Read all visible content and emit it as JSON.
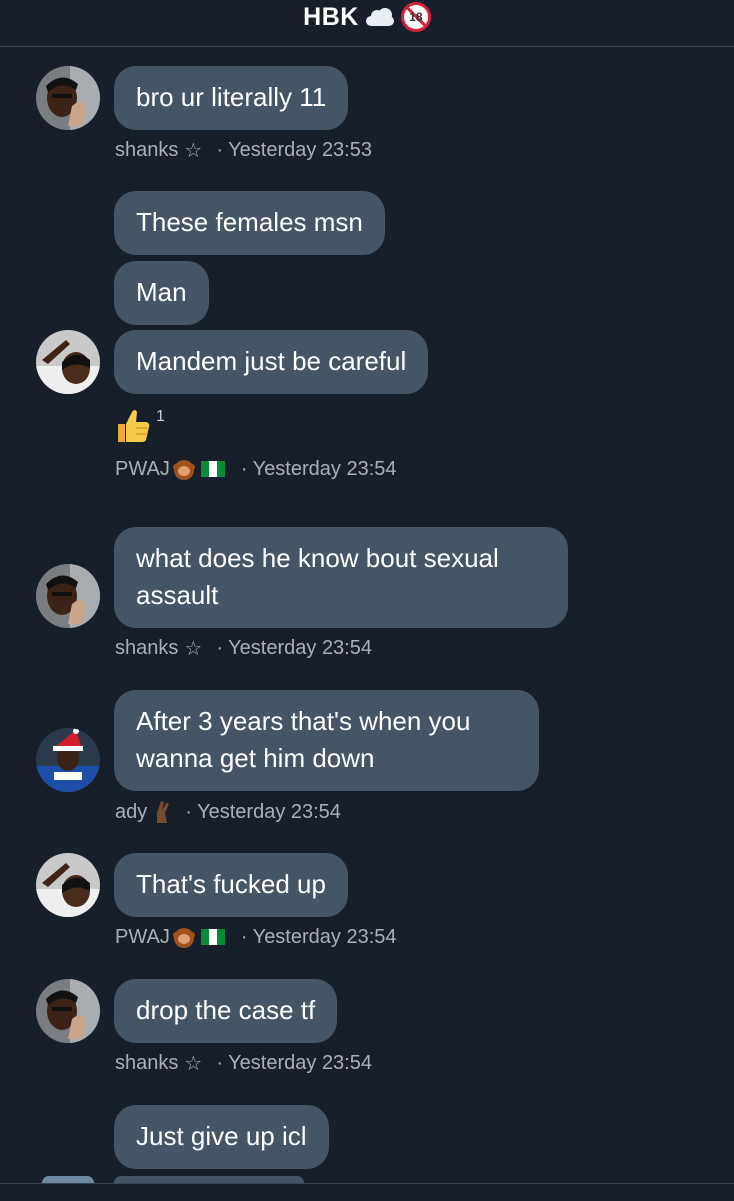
{
  "header": {
    "title": "HBK",
    "icons": [
      "cloud-icon",
      "no-under-18-icon"
    ],
    "badge_text": "18"
  },
  "messages": [
    {
      "text": "bro ur literally 11"
    },
    {
      "text": "These females msn"
    },
    {
      "text": "Man"
    },
    {
      "text": "Mandem just be careful"
    },
    {
      "text": "what does he know bout sexual assault"
    },
    {
      "text": "After 3 years that's when you wanna get him down"
    },
    {
      "text": "That's fucked up"
    },
    {
      "text": "drop the case tf"
    },
    {
      "text": "Just give up icl"
    }
  ],
  "metas": [
    {
      "sender": "shanks",
      "emoji": "☆",
      "time": "· Yesterday 23:53"
    },
    {
      "sender": "PWAJ",
      "emoji": "monkey-icon, nigeria-flag-icon",
      "time": "· Yesterday 23:54"
    },
    {
      "sender": "shanks",
      "emoji": "☆",
      "time": "· Yesterday 23:54"
    },
    {
      "sender": "ady",
      "emoji": "crossed-fingers-icon",
      "time": "· Yesterday 23:54"
    },
    {
      "sender": "PWAJ",
      "emoji": "monkey-icon, nigeria-flag-icon",
      "time": "· Yesterday 23:54"
    },
    {
      "sender": "shanks",
      "emoji": "☆",
      "time": "· Yesterday 23:54"
    }
  ],
  "reaction": {
    "emoji": "thumbs-up-icon",
    "count": "1"
  },
  "colors": {
    "background": "#17202a",
    "bubble": "#455565",
    "meta_text": "#a8b0b8"
  }
}
